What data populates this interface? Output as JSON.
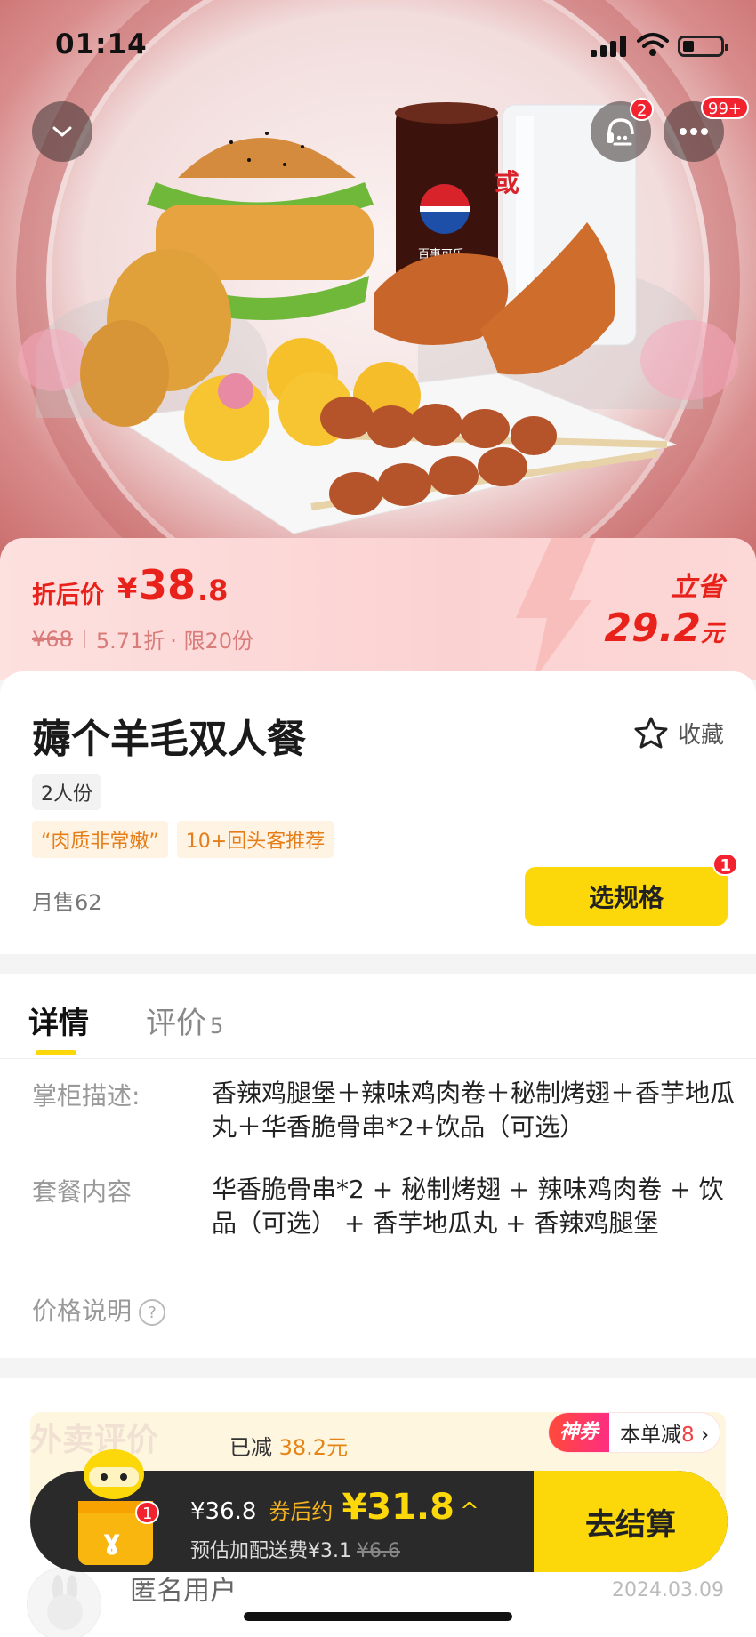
{
  "status_bar": {
    "time": "01:14"
  },
  "hero": {
    "service_badge": "2",
    "more_badge": "99+",
    "drink_choice_mark": "或",
    "drink_brand": "百事可乐"
  },
  "price": {
    "label": "折后价",
    "currency": "¥",
    "integer": "38",
    "decimal": ".8",
    "original": "¥68",
    "discount": "5.71折",
    "limit": "· 限20份",
    "save_label": "立省",
    "save_amount": "29.2",
    "save_unit": "元"
  },
  "product": {
    "title": "薅个羊毛双人餐",
    "favorite_label": "收藏",
    "serving": "2人份",
    "tags": [
      "“肉质非常嫩”",
      "10+回头客推荐"
    ],
    "monthly_sales": "月售62",
    "spec_button": "选规格",
    "spec_badge": "1"
  },
  "tabs": {
    "details": "详情",
    "reviews": "评价",
    "reviews_count": "5"
  },
  "details": {
    "desc_label": "掌柜描述:",
    "desc_value": "香辣鸡腿堡＋辣味鸡肉卷＋秘制烤翅＋香芋地瓜丸＋华香脆骨串*2+饮品（可选）",
    "contents_label": "套餐内容",
    "contents_value": "华香脆骨串*2 + 秘制烤翅 + 辣味鸡肉卷 + 饮品（可选） + 香芋地瓜丸 + 香辣鸡腿堡",
    "price_note_label": "价格说明"
  },
  "reviews_section": {
    "title": "外卖评价",
    "reduced_prefix": "已减",
    "reduced_amount": "38.2元",
    "coupon_tag": "神券",
    "coupon_text": "本单减",
    "coupon_amount": "8",
    "user_name": "匿名用户",
    "date": "2024.03.09"
  },
  "cart": {
    "badge": "1",
    "total": "¥36.8",
    "after_coupon_label": "券后约",
    "after_coupon_price": "¥31.8",
    "delivery_label": "预估加配送费¥3.1",
    "delivery_original": "¥6.6",
    "checkout": "去结算"
  },
  "colors": {
    "accent_yellow": "#fcd80a",
    "price_red": "#e8221b",
    "tag_orange": "#e57e18"
  }
}
